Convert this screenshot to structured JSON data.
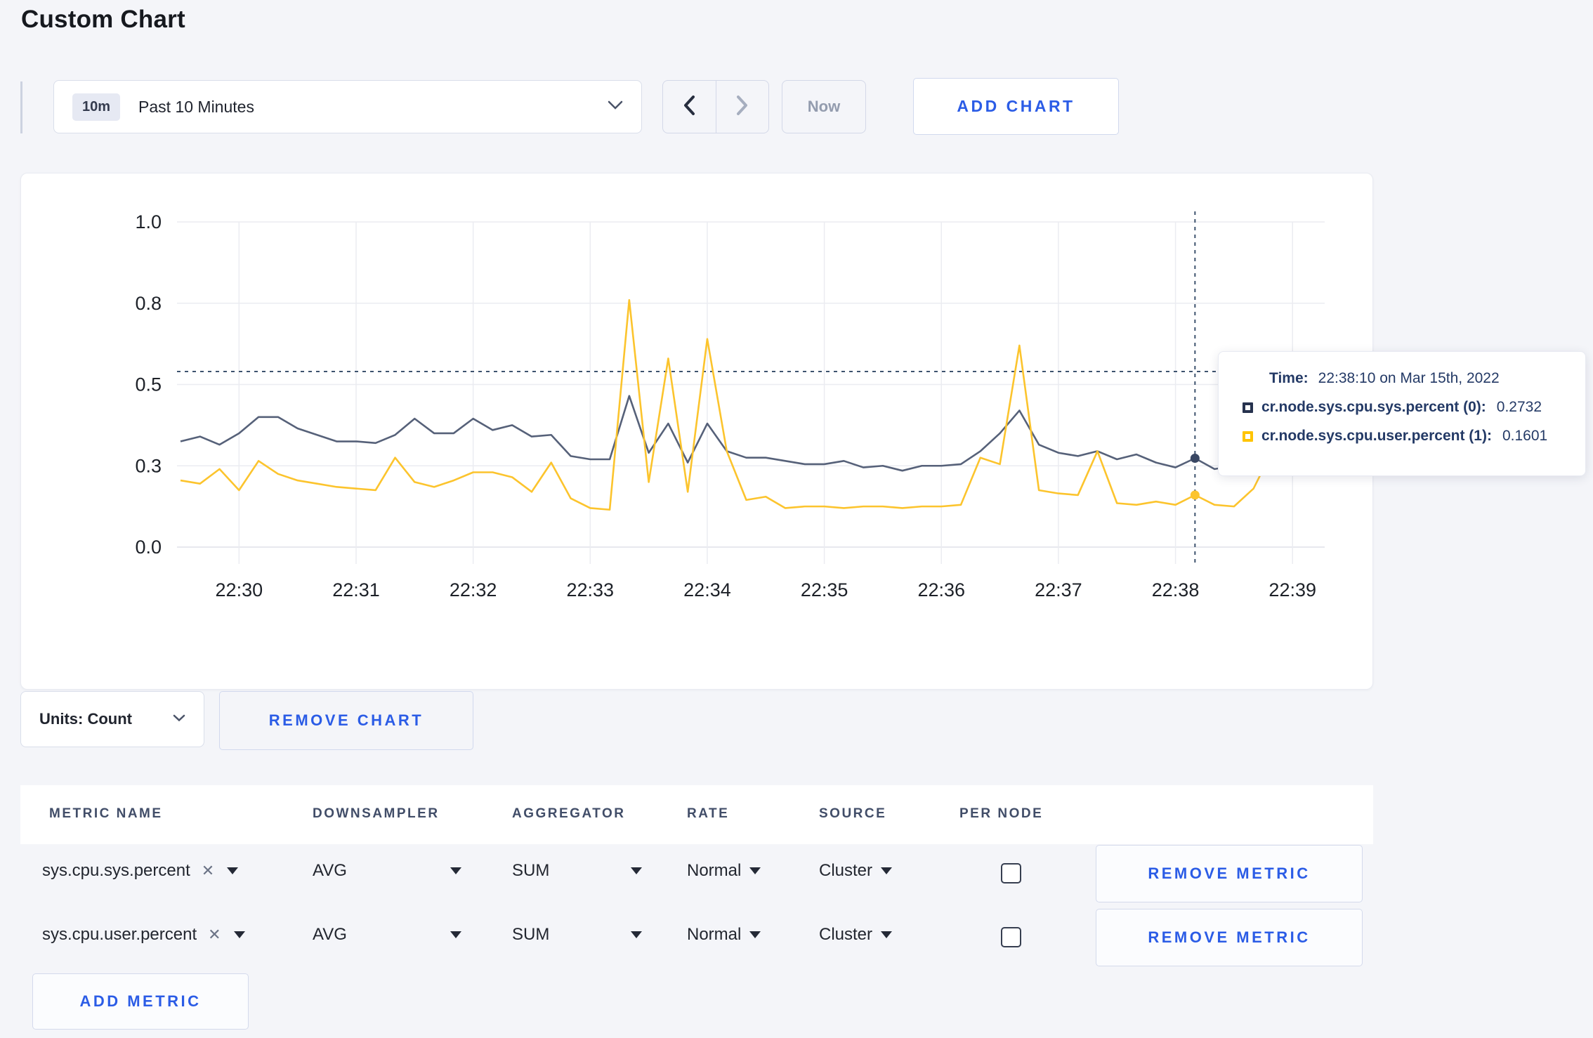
{
  "page": {
    "title": "Custom Chart",
    "background": "#f4f5f9",
    "accent_blue": "#2b5ce6"
  },
  "toolbar": {
    "time_badge": "10m",
    "time_label": "Past 10 Minutes",
    "now_label": "Now",
    "add_chart_label": "ADD CHART"
  },
  "chart_tooltip": {
    "time_label": "Time:",
    "time_value": "22:38:10 on Mar 15th, 2022",
    "series": [
      {
        "name": "cr.node.sys.cpu.sys.percent (0):",
        "value": "0.2732",
        "swatch_color": "#26324e"
      },
      {
        "name": "cr.node.sys.cpu.user.percent (1):",
        "value": "0.1601",
        "swatch_color": "#ffc400"
      }
    ]
  },
  "chart_data": {
    "type": "line",
    "title": "",
    "xlabel": "",
    "ylabel": "",
    "ylim": [
      0,
      1.0
    ],
    "grid": true,
    "x_start": "22:29:30",
    "x_interval_seconds": 10,
    "x_ticks": [
      "22:30",
      "22:31",
      "22:32",
      "22:33",
      "22:34",
      "22:35",
      "22:36",
      "22:37",
      "22:38",
      "22:39"
    ],
    "x_tick_indices": [
      3,
      9,
      15,
      21,
      27,
      33,
      39,
      45,
      51,
      57
    ],
    "y_tick_values": [
      0,
      0.25,
      0.5,
      0.75,
      1.0
    ],
    "y_tick_labels": [
      "0.0",
      "0.3",
      "0.5",
      "0.8",
      "1.0"
    ],
    "grid_color": "#ebecf1",
    "baseline_color": "#dfe1e8",
    "crosshair_color": "#3e536e",
    "hover": {
      "index": 52,
      "time": "22:38:10",
      "crosshair_value": 0.54
    },
    "series": [
      {
        "name": "cr.node.sys.cpu.sys.percent (0)",
        "color": "#566179",
        "dot_color": "#394763",
        "hover_value": 0.2732,
        "values": [
          0.325,
          0.34,
          0.315,
          0.35,
          0.4,
          0.4,
          0.365,
          0.345,
          0.325,
          0.325,
          0.32,
          0.345,
          0.395,
          0.35,
          0.35,
          0.395,
          0.36,
          0.375,
          0.34,
          0.345,
          0.28,
          0.27,
          0.27,
          0.465,
          0.29,
          0.38,
          0.26,
          0.38,
          0.295,
          0.275,
          0.275,
          0.265,
          0.255,
          0.255,
          0.265,
          0.245,
          0.25,
          0.235,
          0.25,
          0.25,
          0.255,
          0.295,
          0.35,
          0.42,
          0.315,
          0.29,
          0.28,
          0.295,
          0.27,
          0.285,
          0.26,
          0.245,
          0.2732,
          0.24,
          0.25,
          0.265,
          0.275,
          0.27,
          0.27
        ]
      },
      {
        "name": "cr.node.sys.cpu.user.percent (1)",
        "color": "#fcc42d",
        "dot_color": "#fcc42d",
        "hover_value": 0.1601,
        "values": [
          0.205,
          0.195,
          0.24,
          0.175,
          0.265,
          0.225,
          0.205,
          0.195,
          0.185,
          0.18,
          0.175,
          0.275,
          0.2,
          0.185,
          0.205,
          0.23,
          0.23,
          0.215,
          0.17,
          0.26,
          0.15,
          0.12,
          0.115,
          0.76,
          0.2,
          0.58,
          0.17,
          0.64,
          0.295,
          0.145,
          0.155,
          0.12,
          0.125,
          0.125,
          0.12,
          0.125,
          0.125,
          0.12,
          0.125,
          0.125,
          0.13,
          0.275,
          0.255,
          0.62,
          0.175,
          0.165,
          0.16,
          0.295,
          0.135,
          0.13,
          0.14,
          0.13,
          0.1601,
          0.13,
          0.125,
          0.18,
          0.3,
          0.285,
          0.235
        ]
      }
    ]
  },
  "chart_controls": {
    "units_label": "Units: Count",
    "remove_chart_label": "REMOVE CHART"
  },
  "metrics_table": {
    "headers": [
      "METRIC NAME",
      "DOWNSAMPLER",
      "AGGREGATOR",
      "RATE",
      "SOURCE",
      "PER NODE"
    ],
    "rows": [
      {
        "metric": "sys.cpu.sys.percent",
        "downsampler": "AVG",
        "aggregator": "SUM",
        "rate": "Normal",
        "source": "Cluster",
        "per_node_checked": false,
        "remove_label": "REMOVE METRIC"
      },
      {
        "metric": "sys.cpu.user.percent",
        "downsampler": "AVG",
        "aggregator": "SUM",
        "rate": "Normal",
        "source": "Cluster",
        "per_node_checked": false,
        "remove_label": "REMOVE METRIC"
      }
    ],
    "add_metric_label": "ADD METRIC"
  }
}
